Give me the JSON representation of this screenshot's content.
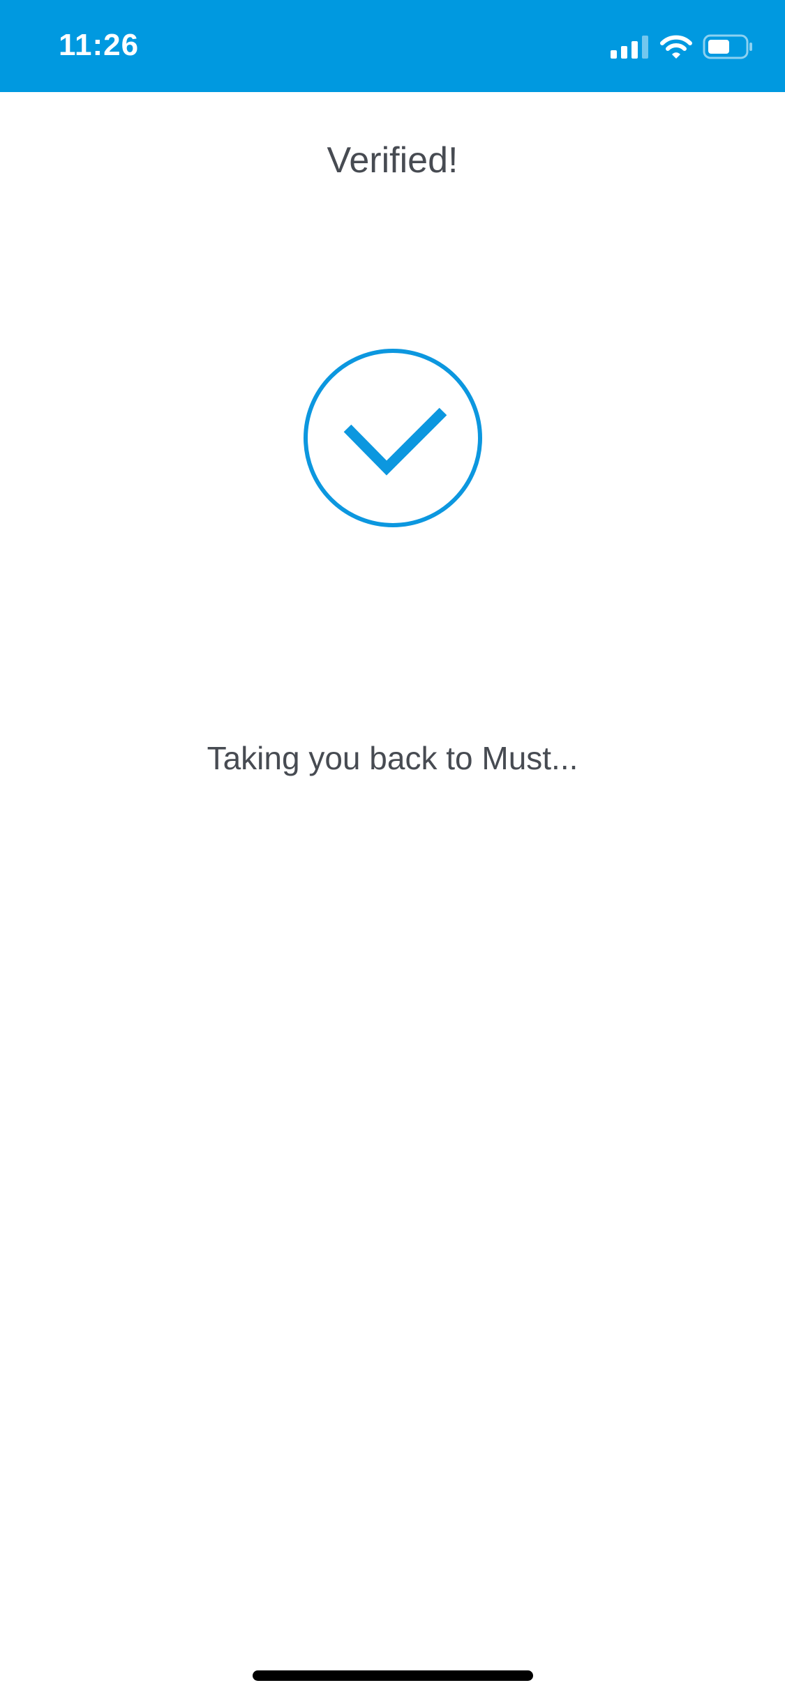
{
  "status_bar": {
    "time": "11:26",
    "background_color": "#0099e0",
    "icons": [
      "cellular-signal-icon",
      "wifi-icon",
      "battery-icon"
    ]
  },
  "main": {
    "title": "Verified!",
    "status_icon": "checkmark-circle-icon",
    "accent_color": "#0c97df",
    "message": "Taking you back to Must..."
  }
}
